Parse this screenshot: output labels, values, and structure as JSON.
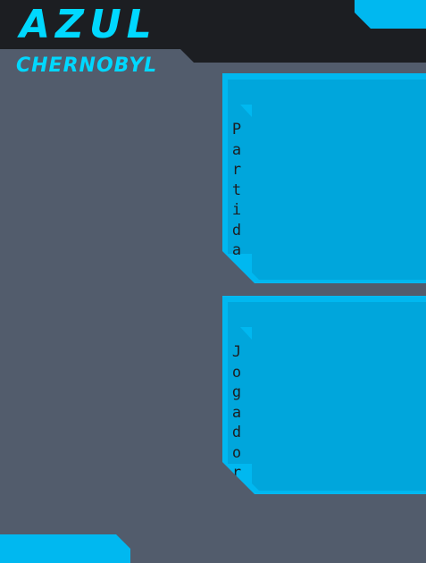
{
  "brand": {
    "title": "AZUL",
    "subtitle": "CHERNOBYL"
  },
  "panels": [
    {
      "id": "partida",
      "label": "Partida"
    },
    {
      "id": "jogador",
      "label": "Jogador"
    }
  ],
  "colors": {
    "background": "#525c6c",
    "header": "#1c1e22",
    "accent": "#00b8f0",
    "panel_fill": "#00a6dc",
    "logo": "#00d8ff"
  }
}
